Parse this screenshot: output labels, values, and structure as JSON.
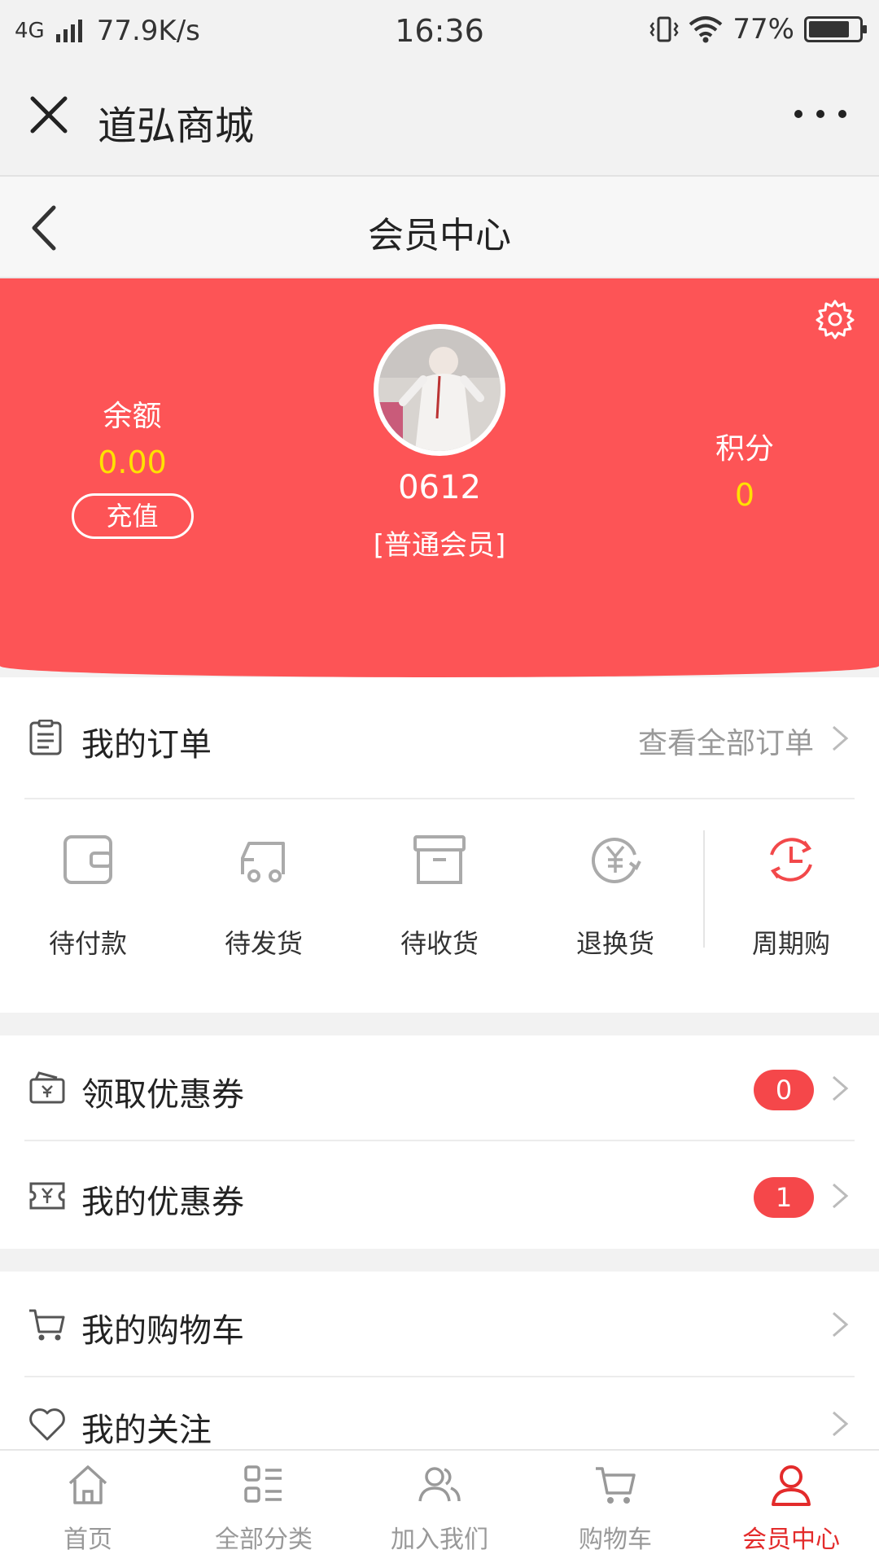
{
  "status_bar": {
    "network": "4G",
    "speed": "77.9K/s",
    "time": "16:36",
    "battery": "77%"
  },
  "wechat_bar": {
    "title": "道弘商城"
  },
  "page_header": {
    "title": "会员中心"
  },
  "profile": {
    "balance_label": "余额",
    "balance_value": "0.00",
    "recharge_label": "充值",
    "username": "0612",
    "member_level": "[普通会员]",
    "points_label": "积分",
    "points_value": "0"
  },
  "orders": {
    "title": "我的订单",
    "view_all": "查看全部订单",
    "items": [
      {
        "label": "待付款",
        "icon": "wallet-icon"
      },
      {
        "label": "待发货",
        "icon": "truck-icon"
      },
      {
        "label": "待收货",
        "icon": "box-icon"
      },
      {
        "label": "退换货",
        "icon": "yuan-refund-icon"
      },
      {
        "label": "周期购",
        "icon": "cycle-clock-icon"
      }
    ]
  },
  "coupons": {
    "get_coupon_label": "领取优惠券",
    "get_coupon_count": "0",
    "my_coupon_label": "我的优惠券",
    "my_coupon_count": "1"
  },
  "misc": {
    "cart_label": "我的购物车",
    "follow_label": "我的关注"
  },
  "tabbar": {
    "items": [
      {
        "label": "首页",
        "icon": "home-icon"
      },
      {
        "label": "全部分类",
        "icon": "category-icon"
      },
      {
        "label": "加入我们",
        "icon": "people-icon"
      },
      {
        "label": "购物车",
        "icon": "cart-icon"
      },
      {
        "label": "会员中心",
        "icon": "user-icon"
      }
    ],
    "active_index": 4
  },
  "colors": {
    "hero_red": "#fd5456",
    "accent_yellow": "#ffe100",
    "active_tab": "#e32b2b",
    "badge": "#f5474a"
  }
}
